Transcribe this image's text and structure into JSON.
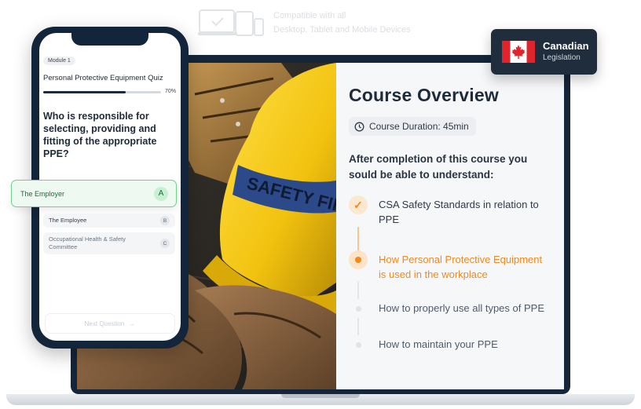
{
  "banner": {
    "device_icon": "devices-icon",
    "line1": "Compatible with all",
    "line2": "Desktop, Tablet and Mobile Devices"
  },
  "course": {
    "title": "Course Overview",
    "duration_icon": "clock-icon",
    "duration": "Course Duration: 45min",
    "subtitle": "After completion of this course you sould be able to understand:",
    "steps": [
      {
        "label": "CSA Safety Standards in relation to PPE",
        "state": "completed"
      },
      {
        "label": "How Personal Protective Equipment is used in the workplace",
        "state": "current"
      },
      {
        "label": "How to properly use all types of PPE",
        "state": "upcoming"
      },
      {
        "label": "How to maintain your PPE",
        "state": "upcoming"
      }
    ],
    "accent_color": "#F08A1C"
  },
  "photo": {
    "helmet_text": "SAFETY FIRST"
  },
  "badge": {
    "flag": "canada-flag-icon",
    "title": "Canadian",
    "subtitle": "Legislation"
  },
  "quiz": {
    "module": "Module 1",
    "title": "Personal Protective Equipment Quiz",
    "progress_percent": 70,
    "progress_label": "70%",
    "question": "Who is responsible for selecting, providing and fitting of the appropriate PPE?",
    "answers": [
      {
        "text": "The Employer",
        "key": "A",
        "selected": true
      },
      {
        "text": "The Employee",
        "key": "B",
        "selected": false
      },
      {
        "text": "Occupational Health & Safety Committee",
        "key": "C",
        "selected": false
      }
    ],
    "next_label": "Next Question",
    "next_icon": "arrow-right-icon"
  },
  "colors": {
    "dark_navy": "#15263A",
    "selected_green": "#6FD18A",
    "helmet_yellow": "#F2C20F"
  }
}
